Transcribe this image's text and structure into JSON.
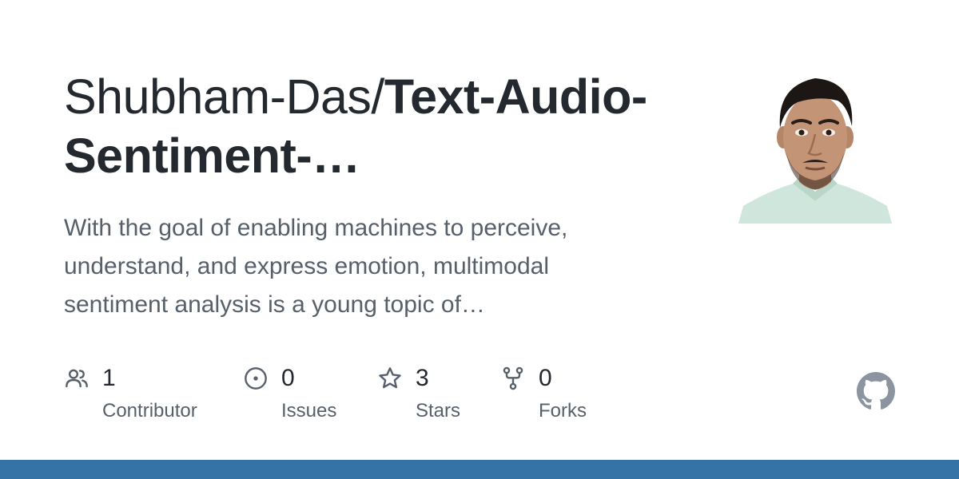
{
  "header": {
    "owner": "Shubham-Das/",
    "repo": "Text-Audio-Sentiment-…"
  },
  "description": "With the goal of enabling machines to perceive, understand, and express emotion, multimodal sentiment analysis is a young topic of…",
  "stats": [
    {
      "value": "1",
      "label": "Contributor",
      "icon": "people-icon"
    },
    {
      "value": "0",
      "label": "Issues",
      "icon": "issue-icon"
    },
    {
      "value": "3",
      "label": "Stars",
      "icon": "star-icon"
    },
    {
      "value": "0",
      "label": "Forks",
      "icon": "fork-icon"
    }
  ],
  "colors": {
    "title": "#24292f",
    "muted": "#57606a",
    "icon": "#57606a",
    "bottom_bar": "#3572A5"
  },
  "icons": {
    "logo": "github-mark-icon",
    "avatar": "owner-avatar"
  }
}
